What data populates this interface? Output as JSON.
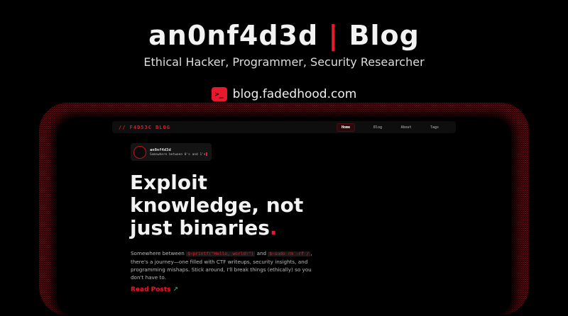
{
  "header": {
    "title_left": "an0nf4d3d",
    "title_sep": "|",
    "title_right": "Blog",
    "subtitle": "Ethical Hacker, Programmer, Security Researcher",
    "url": "blog.fadedhood.com",
    "url_icon": ">_"
  },
  "nav": {
    "brand": "// F4D53C BLOG",
    "items": [
      {
        "label": "Home",
        "active": true
      },
      {
        "label": "Blog"
      },
      {
        "label": "About"
      },
      {
        "label": "Tags"
      }
    ]
  },
  "profile": {
    "name": "an0nf4d3d",
    "tagline": "Somewhere between 0's and 1's"
  },
  "hero": {
    "line1": "Exploit",
    "line2": "knowledge, not",
    "line3": "just binaries",
    "dot": "."
  },
  "description": {
    "p1": "Somewhere between",
    "code1": "$~printf(\"Hello, world!\")",
    "p2": "and",
    "code2": "$~sudo rm -rf /",
    "p3": ", there's a journey—one filled with CTF writeups, security insights, and programming mishaps. Stick around, I'll break things (ethically) so you don't have to."
  },
  "cta": {
    "label": "Read Posts",
    "arrow": "↗"
  },
  "colors": {
    "accent": "#e8192c",
    "background": "#000000"
  }
}
